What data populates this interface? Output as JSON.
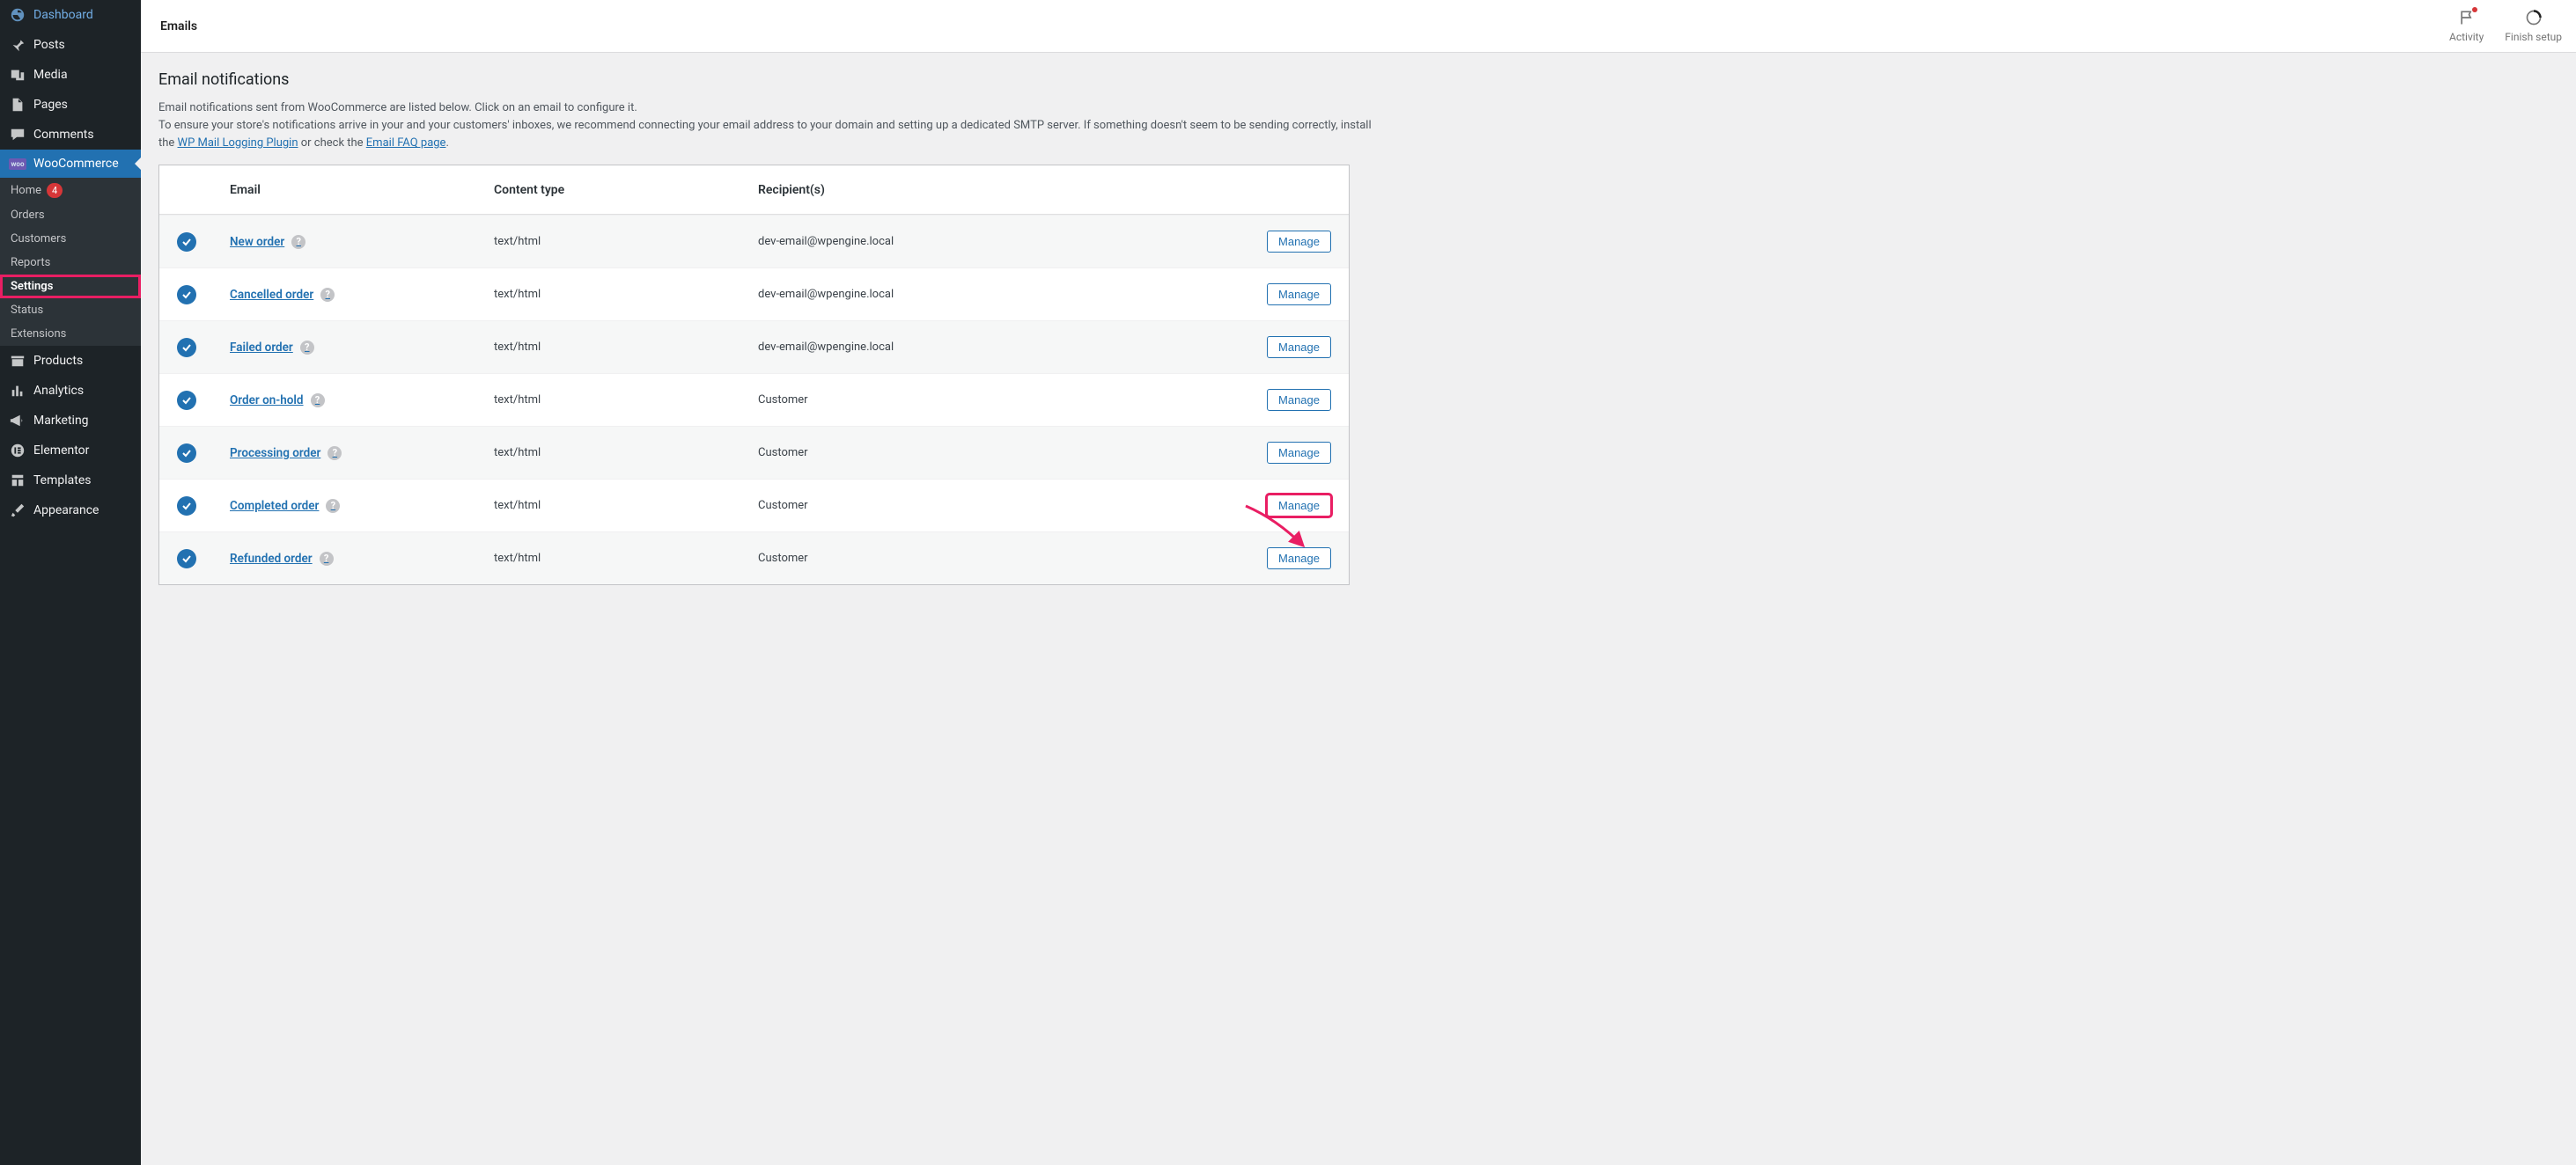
{
  "topbar": {
    "title": "Emails",
    "activity_label": "Activity",
    "finish_setup_label": "Finish setup"
  },
  "sidebar": {
    "items": [
      {
        "label": "Dashboard",
        "icon": "dashboard"
      },
      {
        "label": "Posts",
        "icon": "pin"
      },
      {
        "label": "Media",
        "icon": "media"
      },
      {
        "label": "Pages",
        "icon": "page"
      },
      {
        "label": "Comments",
        "icon": "comment"
      },
      {
        "label": "WooCommerce",
        "icon": "woo",
        "current": true
      },
      {
        "label": "Products",
        "icon": "archive"
      },
      {
        "label": "Analytics",
        "icon": "analytics"
      },
      {
        "label": "Marketing",
        "icon": "megaphone"
      },
      {
        "label": "Elementor",
        "icon": "elementor"
      },
      {
        "label": "Templates",
        "icon": "templates"
      },
      {
        "label": "Appearance",
        "icon": "brush"
      }
    ],
    "woo_submenu": [
      {
        "label": "Home",
        "badge": "4"
      },
      {
        "label": "Orders"
      },
      {
        "label": "Customers"
      },
      {
        "label": "Reports"
      },
      {
        "label": "Settings",
        "current": true
      },
      {
        "label": "Status"
      },
      {
        "label": "Extensions"
      }
    ]
  },
  "page": {
    "heading": "Email notifications",
    "description_1": "Email notifications sent from WooCommerce are listed below. Click on an email to configure it.",
    "description_2a": "To ensure your store's notifications arrive in your and your customers' inboxes, we recommend connecting your email address to your domain and setting up a dedicated SMTP server. If something doesn't seem to be sending correctly, install the ",
    "link_wp_mail": "WP Mail Logging Plugin",
    "description_2b": " or check the ",
    "link_faq": "Email FAQ page",
    "description_2c": "."
  },
  "table": {
    "columns": {
      "email": "Email",
      "content_type": "Content type",
      "recipients": "Recipient(s)"
    },
    "manage_label": "Manage",
    "rows": [
      {
        "name": "New order",
        "content_type": "text/html",
        "recipient": "dev-email@wpengine.local"
      },
      {
        "name": "Cancelled order",
        "content_type": "text/html",
        "recipient": "dev-email@wpengine.local"
      },
      {
        "name": "Failed order",
        "content_type": "text/html",
        "recipient": "dev-email@wpengine.local"
      },
      {
        "name": "Order on-hold",
        "content_type": "text/html",
        "recipient": "Customer"
      },
      {
        "name": "Processing order",
        "content_type": "text/html",
        "recipient": "Customer"
      },
      {
        "name": "Completed order",
        "content_type": "text/html",
        "recipient": "Customer",
        "highlight": true
      },
      {
        "name": "Refunded order",
        "content_type": "text/html",
        "recipient": "Customer"
      }
    ]
  }
}
